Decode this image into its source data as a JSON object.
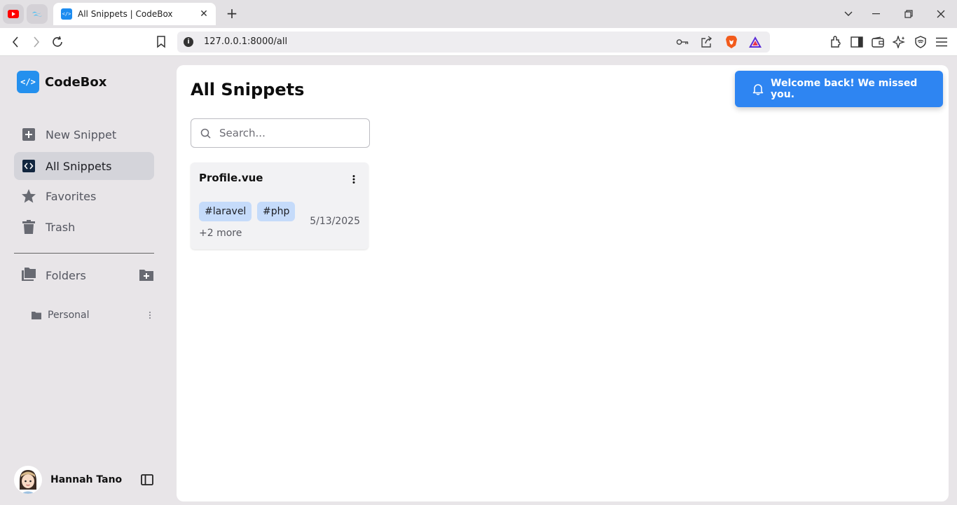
{
  "browser": {
    "tab_title": "All Snippets | CodeBox",
    "favicon_text": "</>",
    "url": "127.0.0.1:8000/all",
    "new_tab": "+",
    "tab_close": "✕"
  },
  "app": {
    "logo_mark": "</>",
    "name": "CodeBox",
    "accent_color": "#2490ee"
  },
  "sidebar": {
    "items": [
      {
        "label": "New Snippet",
        "icon": "plus-square-icon"
      },
      {
        "label": "All Snippets",
        "icon": "code-icon",
        "active": true
      },
      {
        "label": "Favorites",
        "icon": "star-icon"
      },
      {
        "label": "Trash",
        "icon": "trash-icon"
      }
    ],
    "folders_label": "Folders",
    "folders": [
      {
        "label": "Personal"
      }
    ]
  },
  "user": {
    "name": "Hannah Tano"
  },
  "main": {
    "title": "All Snippets",
    "search_placeholder": "Search...",
    "snippets": [
      {
        "title": "Profile.vue",
        "tags": [
          "#laravel",
          "#php"
        ],
        "more": "+2 more",
        "date": "5/13/2025"
      }
    ]
  },
  "toast": {
    "message": "Welcome back! We missed you.",
    "color": "#2e85f2"
  }
}
